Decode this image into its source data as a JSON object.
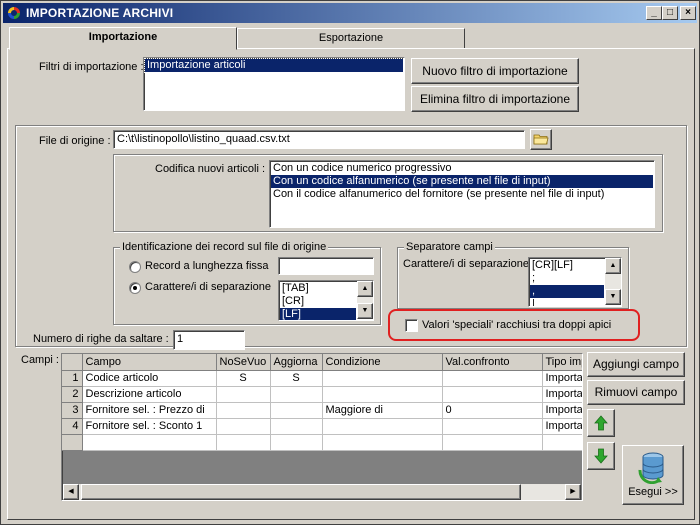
{
  "window": {
    "title": "IMPORTAZIONE ARCHIVI",
    "minimize": "_",
    "maximize": "□",
    "close": "×"
  },
  "tabs": [
    {
      "label": "Importazione",
      "active": true
    },
    {
      "label": "Esportazione",
      "active": false
    }
  ],
  "filters": {
    "label": "Filtri di importazione :",
    "items": [
      "Importazione articoli"
    ],
    "new_button": "Nuovo filtro di importazione",
    "delete_button": "Elimina filtro di importazione"
  },
  "source": {
    "label": "File di origine :",
    "value": "C:\\t\\listinopollo\\listino_quaad.csv.txt"
  },
  "encoding": {
    "label": "Codifica nuovi articoli :",
    "options": [
      "Con un codice numerico progressivo",
      "Con un codice alfanumerico (se presente nel file di input)",
      "Con il codice alfanumerico del fornitore (se presente nel file di input)"
    ],
    "selected_index": 1
  },
  "record_id": {
    "title": "Identificazione dei record sul file di origine",
    "fixed_length_label": "Record a lunghezza fissa",
    "separator_label": "Carattere/i di separazione",
    "separator_items": [
      "[TAB]",
      "[CR]",
      "[LF]"
    ],
    "selected_separator": "[LF]"
  },
  "field_separator": {
    "title": "Separatore campi",
    "label": "Carattere/i di separazione",
    "items": [
      "[CR][LF]",
      ";",
      ",",
      "|"
    ],
    "selected_index": 2
  },
  "quotes_checkbox": {
    "label": "Valori 'speciali' racchiusi tra doppi apici",
    "checked": false
  },
  "skip_rows": {
    "label": "Numero di righe da saltare :",
    "value": "1"
  },
  "fields": {
    "label": "Campi :",
    "headers": [
      "Campo",
      "NoSeVuo",
      "Aggiorna",
      "Condizione",
      "Val.confronto",
      "Tipo imp"
    ],
    "rows": [
      {
        "n": "1",
        "campo": "Codice articolo",
        "nosevuo": "S",
        "aggiorna": "S",
        "condizione": "",
        "val": "",
        "tipo": "Importa"
      },
      {
        "n": "2",
        "campo": "Descrizione articolo",
        "nosevuo": "",
        "aggiorna": "",
        "condizione": "",
        "val": "",
        "tipo": "Importa"
      },
      {
        "n": "3",
        "campo": "Fornitore sel. : Prezzo di",
        "nosevuo": "",
        "aggiorna": "",
        "condizione": "Maggiore di",
        "val": "0",
        "tipo": "Importa"
      },
      {
        "n": "4",
        "campo": "Fornitore sel. : Sconto 1",
        "nosevuo": "",
        "aggiorna": "",
        "condizione": "",
        "val": "",
        "tipo": "Importa"
      }
    ],
    "add_button": "Aggiungi campo",
    "remove_button": "Rimuovi campo",
    "execute_button": "Esegui >>"
  },
  "colors": {
    "selection": "#0a246a",
    "highlight_ring": "#e02020",
    "arrow_green": "#2ea62e"
  }
}
